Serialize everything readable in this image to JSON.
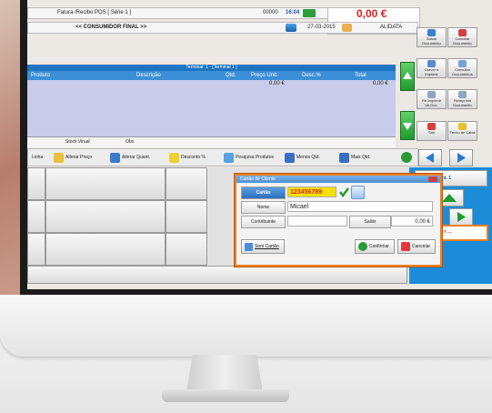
{
  "header": {
    "doc_type": "Fatura /Recibo POS [ Série 1 ]",
    "doc_number": "00000",
    "time": "16:04",
    "total": "0,00 €",
    "client": "<< CONSUMIDOR FINAL >>",
    "date": "27-03-2015",
    "user": "ALIDATA"
  },
  "table": {
    "title": "Terminal: 1 - [Terminal 1 ]",
    "columns": [
      "Produto",
      "Descrição",
      "Qtd.",
      "Preço Unit.",
      "Desc.%",
      "Total"
    ],
    "row": {
      "price": "0,00 €",
      "total": "0,00 €"
    },
    "footer": [
      "Stock Virual",
      "Obs"
    ]
  },
  "toolbar": [
    "Linha",
    "Alterar Preço",
    "Alterar Quant.",
    "Desconto %",
    "Pesquisa Produtos",
    "Menos Qtd.",
    "Mais Qtd."
  ],
  "right_panel": {
    "save": "Salvar Documento",
    "cancel": "Cancelar Documento",
    "save_print": "Gravar e Imprimir",
    "consult": "Consultar Documentos",
    "reprint_last": "Re-Imprimir Ult.Doc.",
    "reprint": "Reimprimir Documento",
    "exit": "Sair",
    "close_cash": "Fecho de Caixa",
    "quantity": "Quant. 1",
    "unknown": "--- ??? ---"
  },
  "dialog": {
    "title": "Cartão de Cliente",
    "card_label": "Cartão",
    "card_value": "123456789",
    "name_label": "Nome",
    "name_value": "Micael",
    "contributor_label": "Contribuinte",
    "balance_label": "Saldo",
    "balance_value": "0,00 €",
    "no_card": "Sem Cartão",
    "confirm": "Confirmar",
    "cancel": "Cancelar"
  },
  "colors": {
    "total_red": "#e02020",
    "table_blue": "#3b8fd6",
    "dialog_orange": "#f07f20",
    "side_blue": "#1d8cd8",
    "card_yellow": "#f6e000"
  }
}
